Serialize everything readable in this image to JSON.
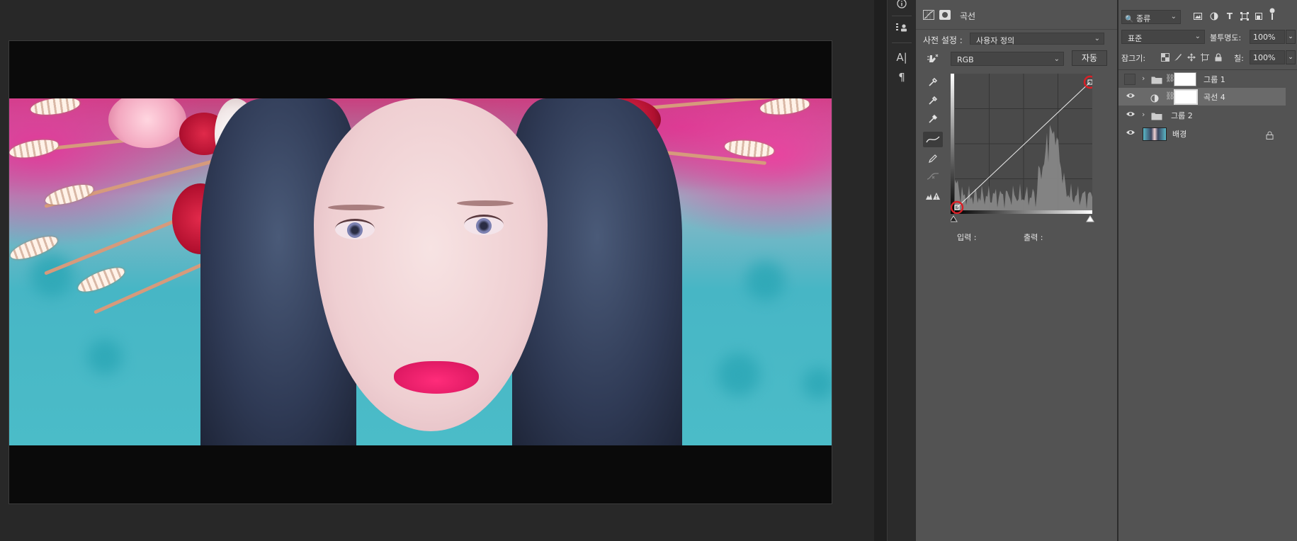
{
  "canvas": {
    "document": "photo-document"
  },
  "toolbar_strip": {
    "info_icon": "info-icon",
    "items": [
      {
        "name": "properties-toggle",
        "glyph": "☷"
      },
      {
        "name": "character-panel",
        "glyph": "A|"
      },
      {
        "name": "paragraph-panel",
        "glyph": "¶"
      }
    ]
  },
  "properties": {
    "title": "곡선",
    "preset_label": "사전 설정 :",
    "preset_value": "사용자 정의",
    "channel_value": "RGB",
    "auto_button": "자동",
    "input_label": "입력 :",
    "output_label": "출력 :",
    "curve_points": [
      [
        0,
        0
      ],
      [
        255,
        255
      ]
    ]
  },
  "layers": {
    "filter_kind": "종류",
    "blend_mode": "표준",
    "opacity_label": "불투명도:",
    "opacity_value": "100%",
    "lock_label": "잠그기:",
    "fill_label": "칠:",
    "fill_value": "100%",
    "items": [
      {
        "name": "그룹 1",
        "type": "group",
        "visible": false
      },
      {
        "name": "곡선 4",
        "type": "adjustment",
        "visible": true,
        "selected": true
      },
      {
        "name": "그룹 2",
        "type": "group",
        "visible": true
      },
      {
        "name": "배경",
        "type": "image",
        "visible": true,
        "locked": true
      }
    ]
  },
  "colors": {
    "panel_bg": "#535353",
    "canvas_bg": "#282828",
    "highlight_circle": "#d81f26",
    "selected_row": "#6a6a6a"
  }
}
